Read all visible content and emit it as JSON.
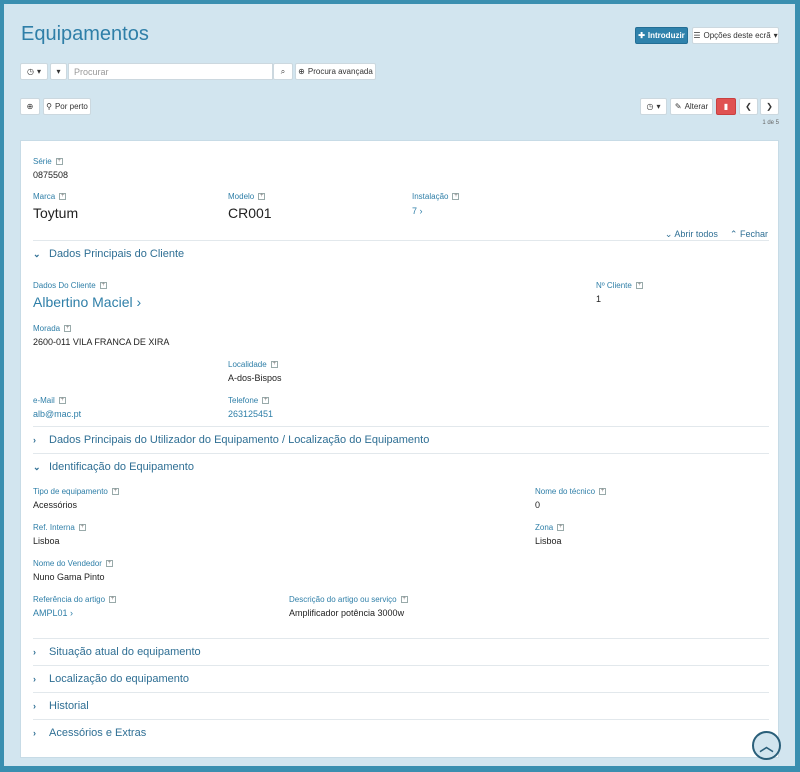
{
  "page": {
    "title": "Equipamentos"
  },
  "toolbar": {
    "introduzir": "Introduzir",
    "opcoes": "Opções deste ecrã",
    "search_placeholder": "Procurar",
    "procura_avancada": "Procura avançada",
    "por_perto": "Por perto",
    "alterar": "Alterar",
    "pager": "1 de 5"
  },
  "record": {
    "serie_label": "Série",
    "serie": "0875508",
    "marca_label": "Marca",
    "marca": "Toytum",
    "modelo_label": "Modelo",
    "modelo": "CR001",
    "instalacao_label": "Instalação",
    "instalacao": "7"
  },
  "sections_actions": {
    "abrir": "Abrir todos",
    "fechar": "Fechar"
  },
  "sections": [
    {
      "title": "Dados Principais do Cliente"
    },
    {
      "title": "Dados Principais do Utilizador do Equipamento / Localização do Equipamento"
    },
    {
      "title": "Identificação do Equipamento"
    },
    {
      "title": "Situação atual do equipamento"
    },
    {
      "title": "Localização do equipamento"
    },
    {
      "title": "Historial"
    },
    {
      "title": "Acessórios e Extras"
    }
  ],
  "cliente": {
    "dados_label": "Dados Do Cliente",
    "dados": "Albertino Maciel",
    "ncliente_label": "Nº Cliente",
    "ncliente": "1",
    "morada_label": "Morada",
    "morada": "2600-011 VILA FRANCA DE XIRA",
    "localidade_label": "Localidade",
    "localidade": "A-dos-Bispos",
    "email_label": "e-Mail",
    "email": "alb@mac.pt",
    "telefone_label": "Telefone",
    "telefone": "263125451"
  },
  "identificacao": {
    "tipo_label": "Tipo de equipamento",
    "tipo": "Acessórios",
    "tecnico_label": "Nome do técnico",
    "tecnico": "0",
    "ref_label": "Ref. Interna",
    "ref": "Lisboa",
    "zona_label": "Zona",
    "zona": "Lisboa",
    "vendedor_label": "Nome do Vendedor",
    "vendedor": "Nuno Gama Pinto",
    "refartigo_label": "Referência do artigo",
    "refartigo": "AMPL01",
    "desc_label": "Descrição do artigo ou serviço",
    "desc": "Amplificador potência 3000w"
  },
  "colors": {
    "accent": "#2f82ac",
    "background": "#d2e5ef",
    "danger": "#e05252"
  }
}
